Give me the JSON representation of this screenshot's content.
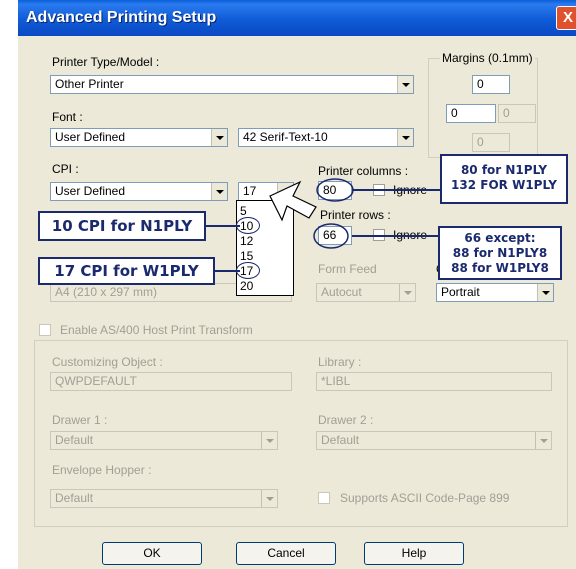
{
  "window": {
    "title": "Advanced Printing Setup",
    "close_glyph": "X"
  },
  "printer_type": {
    "label": "Printer Type/Model :",
    "value": "Other Printer"
  },
  "margins": {
    "label": "Margins (0.1mm)",
    "top": "0",
    "left": "0",
    "right": "0",
    "bottom": "0"
  },
  "font": {
    "label": "Font :",
    "value": "User Defined",
    "name": "42 Serif-Text-10"
  },
  "cpi": {
    "label": "CPI :",
    "value": "User Defined",
    "selected": "17",
    "options": [
      "5",
      "10",
      "12",
      "15",
      "17",
      "20"
    ]
  },
  "printer_columns": {
    "label": "Printer columns :",
    "value": "80",
    "ignore_label": "Ignore"
  },
  "printer_rows": {
    "label": "Printer rows :",
    "value": "66",
    "ignore_label": "Ignore"
  },
  "paper": {
    "value": "A4 (210 x 297 mm)"
  },
  "form_feed": {
    "label": "Form Feed",
    "value": "Autocut"
  },
  "orientation": {
    "label_fragment": "O",
    "value": "Portrait"
  },
  "as400": {
    "label": "Enable AS/400 Host Print Transform"
  },
  "customizing_object": {
    "label": "Customizing Object :",
    "value": "QWPDEFAULT"
  },
  "library": {
    "label": "Library :",
    "value": "*LIBL"
  },
  "drawer1": {
    "label": "Drawer 1 :",
    "value": "Default"
  },
  "drawer2": {
    "label": "Drawer 2 :",
    "value": "Default"
  },
  "envelope": {
    "label": "Envelope Hopper :",
    "value": "Default"
  },
  "ascii": {
    "label": "Supports ASCII Code-Page 899"
  },
  "buttons": {
    "ok": "OK",
    "cancel": "Cancel",
    "help": "Help"
  },
  "annotations": {
    "cpi_n1ply": "10 CPI for N1PLY",
    "cpi_w1ply": "17 CPI for W1PLY",
    "columns_line1": "80 for N1PLY",
    "columns_line2": "132 FOR W1PLY",
    "rows_line1": "66 except:",
    "rows_line2": "88 for N1PLY8",
    "rows_line3": "88 for W1PLY8"
  },
  "colors": {
    "title_bar": "#0a5fd8",
    "dialog_bg": "#ece9d8",
    "annotation": "#1b2a6e",
    "close_button": "#e0522e"
  }
}
